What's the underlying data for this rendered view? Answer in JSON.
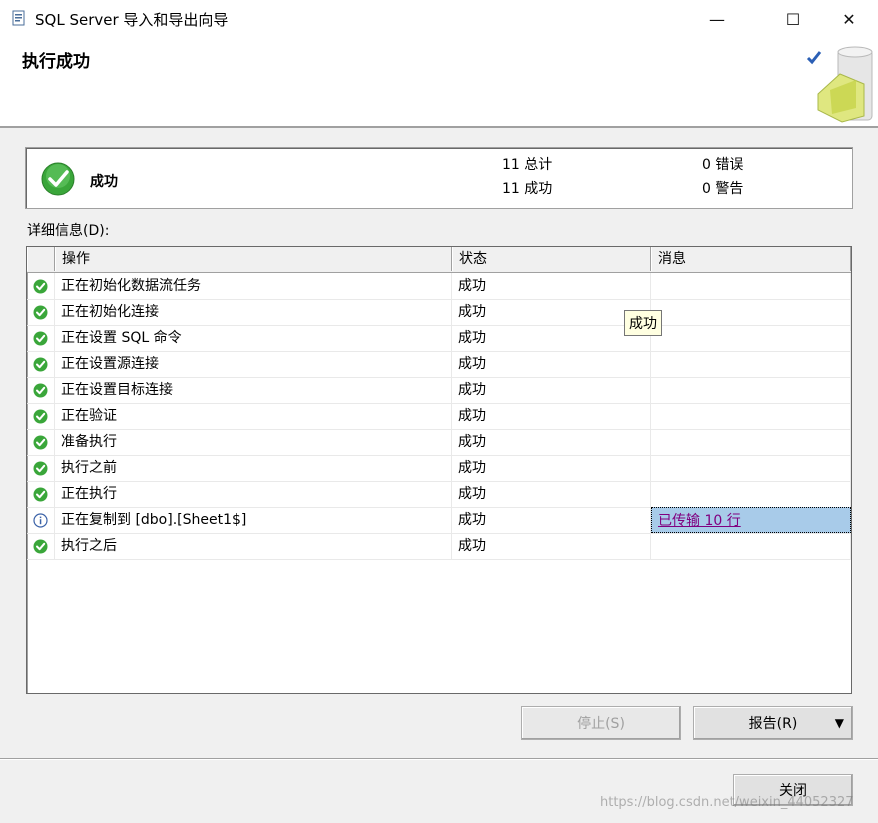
{
  "window": {
    "title": "SQL Server 导入和导出向导",
    "controls": {
      "minimize": "—",
      "maximize": "☐",
      "close": "✕"
    }
  },
  "header": {
    "title": "执行成功"
  },
  "summary": {
    "status": "成功",
    "total": "11 总计",
    "success": "11 成功",
    "errors": "0 错误",
    "warnings": "0 警告"
  },
  "details": {
    "label": "详细信息(D):",
    "columns": [
      "操作",
      "状态",
      "消息"
    ],
    "rows": [
      {
        "icon": "success-icon",
        "action": "正在初始化数据流任务",
        "status": "成功",
        "message": ""
      },
      {
        "icon": "success-icon",
        "action": "正在初始化连接",
        "status": "成功",
        "message": ""
      },
      {
        "icon": "success-icon",
        "action": "正在设置 SQL 命令",
        "status": "成功",
        "message": ""
      },
      {
        "icon": "success-icon",
        "action": "正在设置源连接",
        "status": "成功",
        "message": ""
      },
      {
        "icon": "success-icon",
        "action": "正在设置目标连接",
        "status": "成功",
        "message": ""
      },
      {
        "icon": "success-icon",
        "action": "正在验证",
        "status": "成功",
        "message": ""
      },
      {
        "icon": "success-icon",
        "action": "准备执行",
        "status": "成功",
        "message": ""
      },
      {
        "icon": "success-icon",
        "action": "执行之前",
        "status": "成功",
        "message": ""
      },
      {
        "icon": "success-icon",
        "action": "正在执行",
        "status": "成功",
        "message": ""
      },
      {
        "icon": "info-icon",
        "action": "正在复制到 [dbo].[Sheet1$]",
        "status": "成功",
        "message": "已传输 10 行"
      },
      {
        "icon": "success-icon",
        "action": "执行之后",
        "status": "成功",
        "message": ""
      }
    ],
    "tooltip": "成功"
  },
  "buttons": {
    "stop": "停止(S)",
    "report": "报告(R)",
    "report_arrow": "▼",
    "close": "关闭"
  },
  "watermark": "https://blog.csdn.net/weixin_44052327",
  "colors": {
    "success": "#3aa63a",
    "link_visited": "#800080",
    "selection": "#a8cbe9",
    "tooltip_bg": "#ffffe1"
  }
}
